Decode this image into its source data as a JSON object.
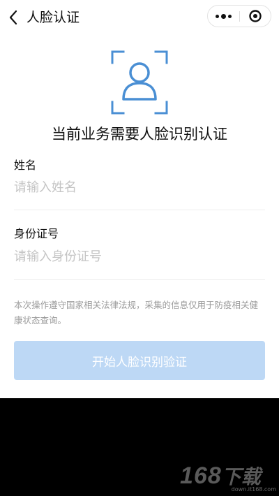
{
  "navbar": {
    "title": "人脸认证"
  },
  "headline": "当前业务需要人脸识别认证",
  "form": {
    "name": {
      "label": "姓名",
      "placeholder": "请输入姓名",
      "value": ""
    },
    "id_number": {
      "label": "身份证号",
      "placeholder": "请输入身份证号",
      "value": ""
    }
  },
  "notice": "本次操作遵守国家相关法律法规，采集的信息仅用于防疫相关健康状态查询。",
  "submit": {
    "label": "开始人脸识别验证",
    "state": "disabled"
  },
  "colors": {
    "accent": "#4a8fd4",
    "button_disabled": "#bdd8f5",
    "placeholder": "#c4c4c4",
    "notice": "#9a9a9a"
  },
  "watermark": {
    "brand": "168",
    "suffix": "下载",
    "url": "down.it168.com"
  }
}
